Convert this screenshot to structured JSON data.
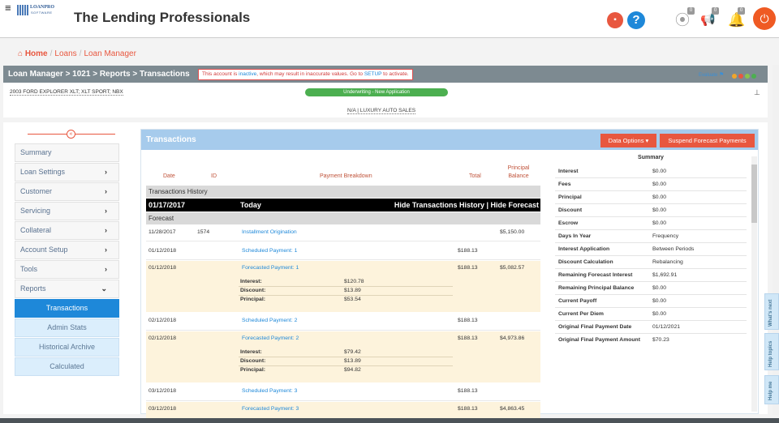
{
  "app": {
    "title": "The Lending Professionals",
    "logo_top": "LOANPRO",
    "logo_bottom": "SOFTWARE",
    "menu_icon": "≡",
    "chat_icon": "chat-icon",
    "help_icon": "?",
    "badges": [
      "0",
      "0",
      "0"
    ],
    "power_icon": "⏻"
  },
  "breadcrumb": {
    "home": "Home",
    "loans": "Loans",
    "manager": "Loan Manager"
  },
  "loan_header": {
    "title": "Loan Manager > 1021 > Reports > Transactions",
    "alert_pre": "This account is ",
    "alert_inactive": "inactive",
    "alert_mid": ", which may result in inaccurate values. Go to ",
    "alert_setup": "SETUP",
    "alert_post": " to activate.",
    "evaluate": "Evaluate",
    "dot_colors": [
      "#f0a52b",
      "#e8573f",
      "#8bc34a",
      "#4caf50"
    ]
  },
  "subbar": {
    "vehicle": "2003 FORD EXPLORER XLT; XLT SPORT; NBX",
    "status": "Underwriting - New Application",
    "dealer": "N/A | LUXURY AUTO SALES"
  },
  "sidebar": {
    "collapse": "«",
    "items": [
      {
        "label": "Summary",
        "arrow": ""
      },
      {
        "label": "Loan Settings",
        "arrow": "›"
      },
      {
        "label": "Customer",
        "arrow": "›"
      },
      {
        "label": "Servicing",
        "arrow": "›"
      },
      {
        "label": "Collateral",
        "arrow": "›"
      },
      {
        "label": "Account Setup",
        "arrow": "›"
      },
      {
        "label": "Tools",
        "arrow": "›"
      },
      {
        "label": "Reports",
        "arrow": "⌄"
      }
    ],
    "reports": [
      "Transactions",
      "Admin Stats",
      "Historical Archive",
      "Calculated"
    ]
  },
  "panel": {
    "title": "Transactions",
    "data_options": "Data Options",
    "caret": "▾",
    "suspend": "Suspend Forecast Payments"
  },
  "table": {
    "headers": {
      "date": "Date",
      "id": "ID",
      "breakdown": "Payment Breakdown",
      "total": "Total",
      "principal_balance": "Principal Balance"
    },
    "history_label": "Transactions History",
    "today_date": "01/17/2017",
    "today": "Today",
    "hide_links": "Hide Transactions History | Hide Forecast",
    "forecast_label": "Forecast",
    "rows": [
      {
        "date": "11/28/2017",
        "id": "1574",
        "desc": "Installment Origination",
        "total": "",
        "balance": "$5,150.00"
      },
      {
        "date": "01/12/2018",
        "id": "",
        "desc": "Scheduled Payment: 1",
        "total": "$188.13",
        "balance": ""
      },
      {
        "date": "01/12/2018",
        "id": "",
        "desc": "Forecasted Payment: 1",
        "total": "$188.13",
        "balance": "$5,082.57",
        "breakdown": [
          {
            "k": "Interest:",
            "v": "$120.78"
          },
          {
            "k": "Discount:",
            "v": "$13.89"
          },
          {
            "k": "Principal:",
            "v": "$53.54"
          }
        ]
      },
      {
        "date": "02/12/2018",
        "id": "",
        "desc": "Scheduled Payment: 2",
        "total": "$188.13",
        "balance": ""
      },
      {
        "date": "02/12/2018",
        "id": "",
        "desc": "Forecasted Payment: 2",
        "total": "$188.13",
        "balance": "$4,973.86",
        "breakdown": [
          {
            "k": "Interest:",
            "v": "$79.42"
          },
          {
            "k": "Discount:",
            "v": "$13.89"
          },
          {
            "k": "Principal:",
            "v": "$94.82"
          }
        ]
      },
      {
        "date": "03/12/2018",
        "id": "",
        "desc": "Scheduled Payment: 3",
        "total": "$188.13",
        "balance": ""
      },
      {
        "date": "03/12/2018",
        "id": "",
        "desc": "Forecasted Payment: 3",
        "total": "$188.13",
        "balance": "$4,863.45"
      }
    ]
  },
  "summary": {
    "title": "Summary",
    "rows": [
      {
        "k": "Interest",
        "v": "$0.00"
      },
      {
        "k": "Fees",
        "v": "$0.00"
      },
      {
        "k": "Principal",
        "v": "$0.00"
      },
      {
        "k": "Discount",
        "v": "$0.00"
      },
      {
        "k": "Escrow",
        "v": "$0.00"
      },
      {
        "k": "Days In Year",
        "v": "Frequency"
      },
      {
        "k": "Interest Application",
        "v": "Between Periods"
      },
      {
        "k": "Discount Calculation",
        "v": "Rebalancing"
      },
      {
        "k": "Remaining Forecast Interest",
        "v": "$1,692.91"
      },
      {
        "k": "Remaining Principal Balance",
        "v": "$0.00"
      },
      {
        "k": "Current Payoff",
        "v": "$0.00"
      },
      {
        "k": "Current Per Diem",
        "v": "$0.00"
      },
      {
        "k": "Original Final Payment Date",
        "v": "01/12/2021"
      },
      {
        "k": "Original Final Payment Amount",
        "v": "$70.23"
      }
    ]
  },
  "side_tabs": [
    "What's next",
    "Help topics",
    "Help me"
  ]
}
